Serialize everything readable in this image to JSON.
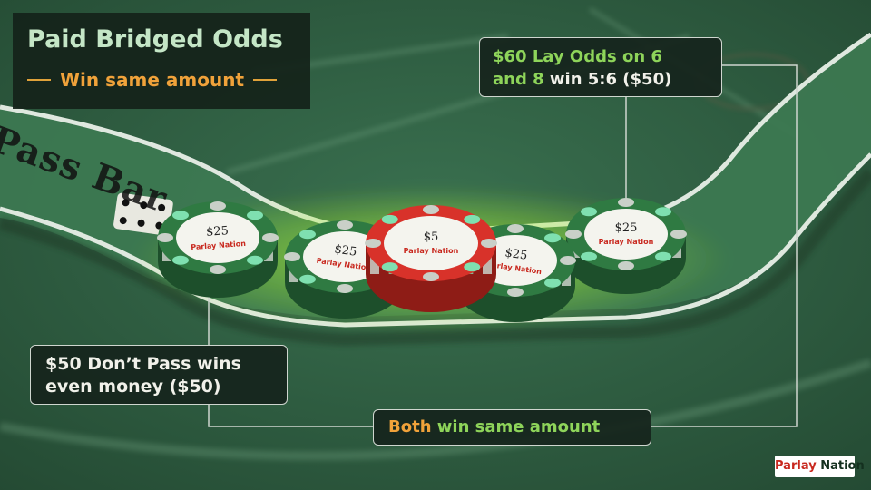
{
  "title": "Paid Bridged Odds",
  "subtitle": "Win same amount",
  "callouts": {
    "lay_odds": {
      "line1_amount": "$60 Lay Odds on 6",
      "line2_numbers": "and 8",
      "line2_rest": " win 5:6 ($50)"
    },
    "dont_pass": {
      "line1": "$50 Don’t Pass wins",
      "line2": "even money ($50)"
    },
    "both": {
      "highlight": "Both",
      "rest": " win same amount"
    }
  },
  "table_text": "Pass Bar",
  "chips": [
    {
      "denomination": "25",
      "brand": "Parlay Nation",
      "color": "green"
    },
    {
      "denomination": "25",
      "brand": "Parlay Nation",
      "color": "green"
    },
    {
      "denomination": "5",
      "brand": "Parlay Nation",
      "color": "red"
    },
    {
      "denomination": "25",
      "brand": "Parlay Nation",
      "color": "green"
    },
    {
      "denomination": "25",
      "brand": "Parlay Nation",
      "color": "green"
    }
  ],
  "logo": {
    "part1": "Parlay",
    "part2": "Nation"
  },
  "colors": {
    "felt": "#2f5f40",
    "rail": "#3b7a52",
    "accent_green": "#8ed45a",
    "accent_orange": "#f0a23a",
    "chip_green": "#2f7a42",
    "chip_red": "#d8322a",
    "glow": "#b8ff3c"
  }
}
